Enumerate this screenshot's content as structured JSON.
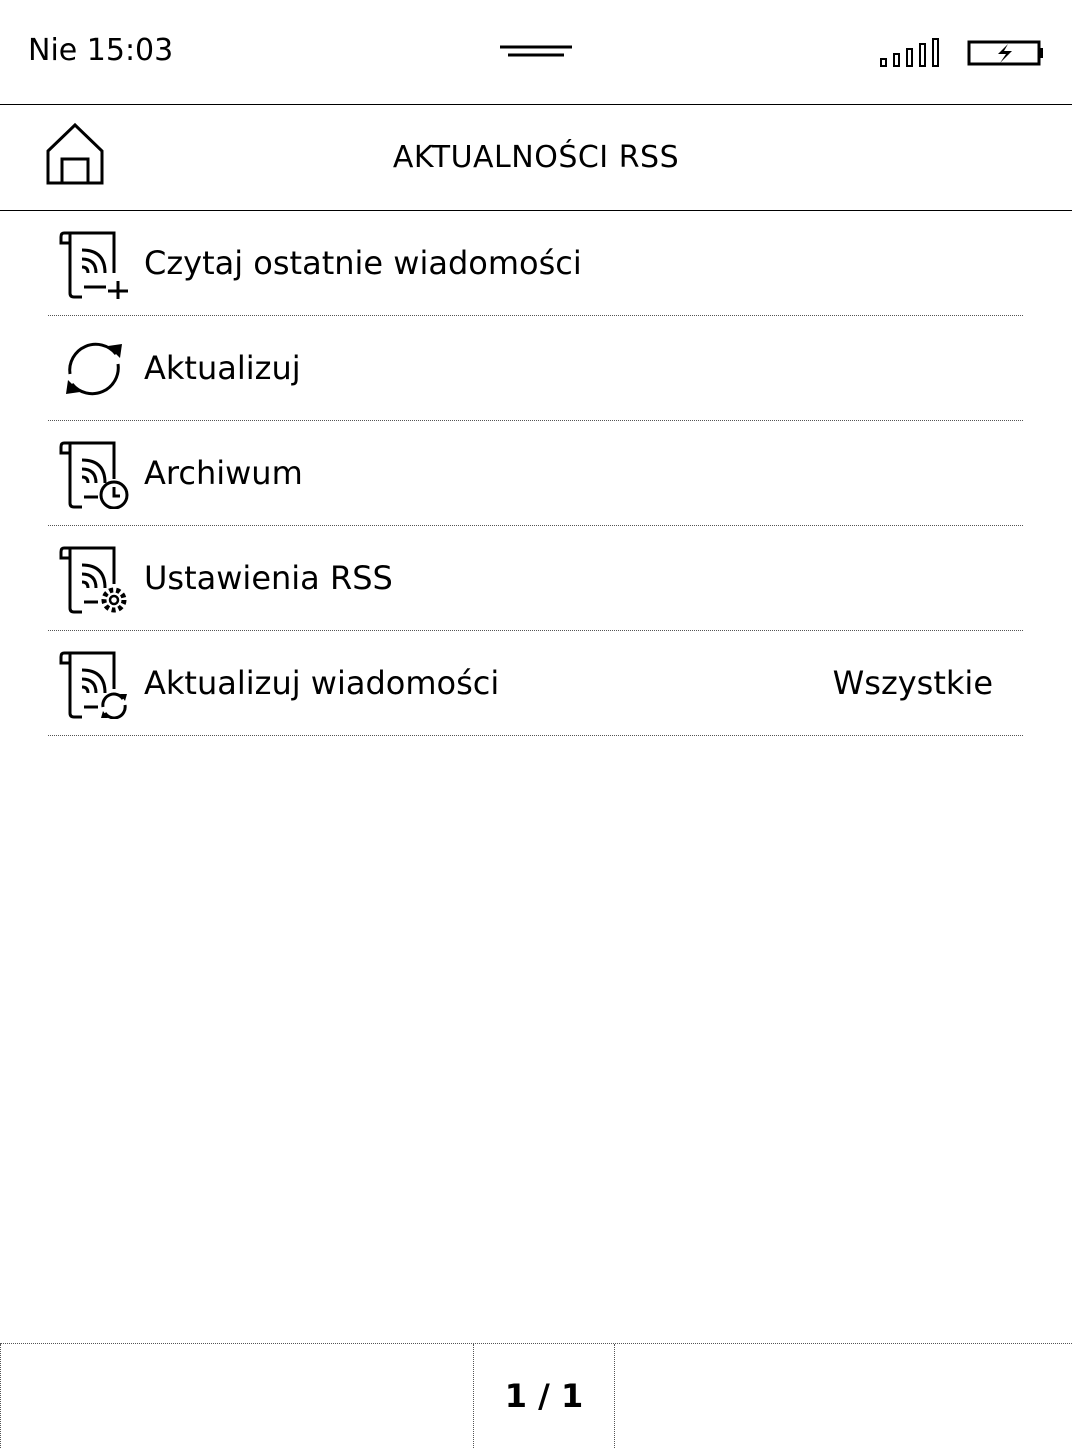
{
  "status_bar": {
    "time": "Nie 15:03",
    "icons": [
      "menu-handle-icon",
      "signal-icon",
      "battery-charging-icon"
    ]
  },
  "header": {
    "title": "AKTUALNOŚCI RSS",
    "home_icon": "home-icon"
  },
  "menu": {
    "items": [
      {
        "label": "Czytaj ostatnie wiadomości",
        "icon": "rss-add-icon"
      },
      {
        "label": "Aktualizuj",
        "icon": "sync-icon"
      },
      {
        "label": "Archiwum",
        "icon": "rss-clock-icon"
      },
      {
        "label": "Ustawienia RSS",
        "icon": "rss-gear-icon"
      },
      {
        "label": "Aktualizuj wiadomości",
        "value": "Wszystkie",
        "icon": "rss-sync-icon"
      }
    ]
  },
  "footer": {
    "page_indicator": "1 / 1"
  }
}
